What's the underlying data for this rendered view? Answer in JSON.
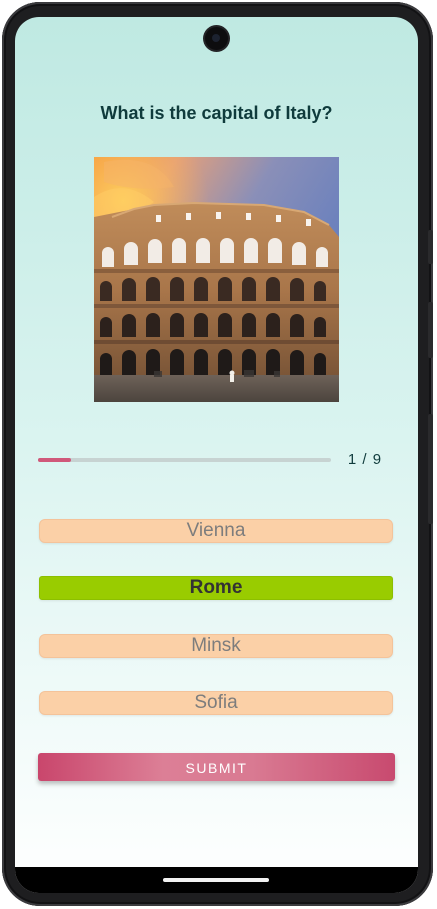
{
  "quiz": {
    "question": "What is the capital of Italy?",
    "image_subject": "colosseum-photo",
    "progress": {
      "current": 1,
      "total": 9,
      "label": "1 / 9",
      "fraction": 0.111
    },
    "options": [
      {
        "label": "Vienna",
        "selected": false
      },
      {
        "label": "Rome",
        "selected": true
      },
      {
        "label": "Minsk",
        "selected": false
      },
      {
        "label": "Sofia",
        "selected": false
      }
    ],
    "submit_label": "SUBMIT"
  },
  "colors": {
    "accent": "#d0587a",
    "option_bg": "#fbd0a7",
    "selected_bg": "#99cc00",
    "question_text": "#0f3b3c"
  }
}
